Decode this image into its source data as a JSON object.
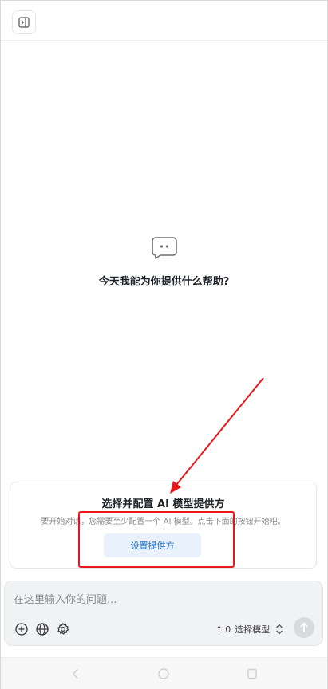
{
  "empty_state": {
    "title": "今天我能为你提供什么帮助?"
  },
  "provider_card": {
    "title": "选择并配置 AI 模型提供方",
    "description": "要开始对话，您需要至少配置一个 AI 模型。点击下面的按钮开始吧。",
    "button_label": "设置提供方"
  },
  "composer": {
    "placeholder": "在这里输入你的问题...",
    "model_count": "0",
    "model_label": "选择模型"
  },
  "colors": {
    "accent": "#1a6fd1",
    "accent_bg": "#e8f1fc",
    "annotation": "#e8161b"
  },
  "icons": [
    "sidebar-toggle-icon",
    "chat-bubble-icon",
    "plus-icon",
    "globe-icon",
    "gear-icon",
    "sort-icon",
    "send-icon",
    "back-icon",
    "home-icon",
    "recents-icon"
  ]
}
